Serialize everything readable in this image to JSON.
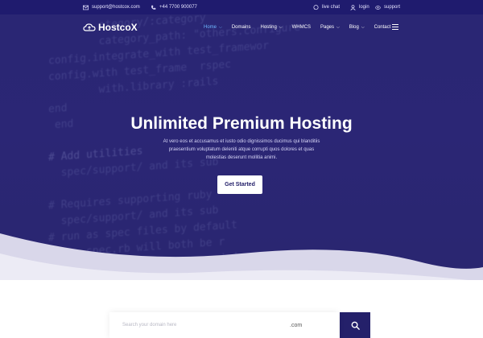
{
  "topbar": {
    "email": "support@hostcox.com",
    "phone": "+44 7700 900077",
    "live_chat": "live chat",
    "login": "login",
    "support": "support"
  },
  "brand": {
    "name": "HostcoX"
  },
  "nav": {
    "items": [
      {
        "label": "Home",
        "dropdown": true,
        "active": true
      },
      {
        "label": "Domains",
        "dropdown": false
      },
      {
        "label": "Hosting",
        "dropdown": true
      },
      {
        "label": "WHMCS",
        "dropdown": false
      },
      {
        "label": "Pages",
        "dropdown": true
      },
      {
        "label": "Blog",
        "dropdown": true
      },
      {
        "label": "Contact",
        "dropdown": false
      }
    ]
  },
  "hero": {
    "title": "Unlimited Premium Hosting",
    "text_lines": [
      "At vero eos et accusamus et iusto odio dignissimos ducimus qui blanditiis",
      "praesentium voluptatum deleniti atque corrupti quos dolores et quas",
      "molestias deserunt mollitia animi."
    ],
    "cta_label": "Get Started"
  },
  "domain_search": {
    "placeholder": "Search your domain here",
    "tld": ".com"
  },
  "colors": {
    "topbar": "#1f1b6e",
    "hero_bg": "#2a2674",
    "accent_active": "#6fb8ff",
    "button_dark": "#24206a"
  }
}
